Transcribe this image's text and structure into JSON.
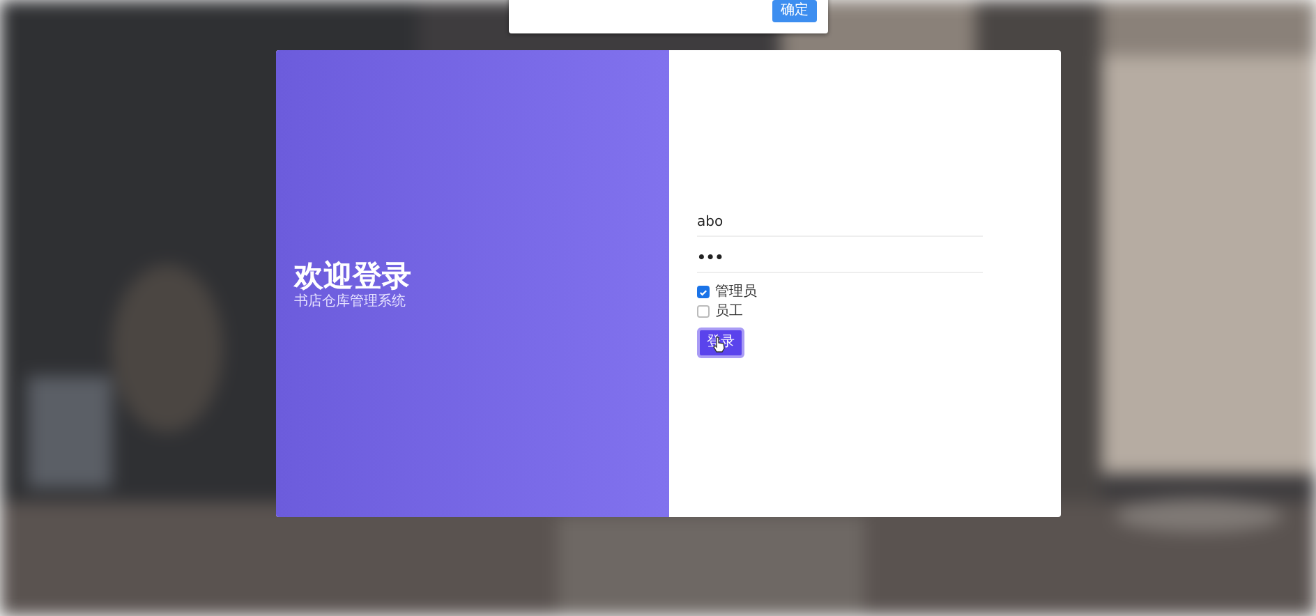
{
  "dialog": {
    "button": "确定"
  },
  "welcome": {
    "title": "欢迎登录",
    "subtitle": "书店仓库管理系统"
  },
  "form": {
    "username": "abo",
    "password": "•••",
    "roles": [
      {
        "label": "管理员",
        "checked": true
      },
      {
        "label": "员工",
        "checked": false
      }
    ],
    "submit": "登录"
  }
}
